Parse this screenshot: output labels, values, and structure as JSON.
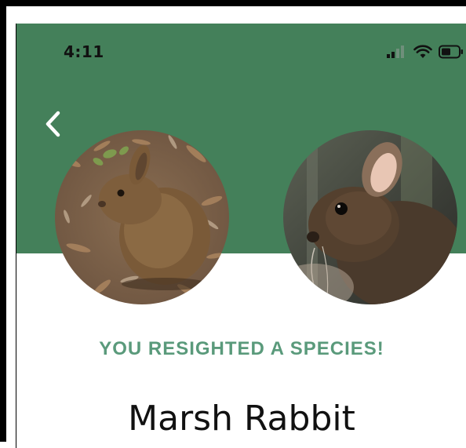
{
  "status_bar": {
    "time": "4:11",
    "signal_icon": "cellular-signal-icon",
    "wifi_icon": "wifi-icon",
    "battery_icon": "battery-icon"
  },
  "nav": {
    "back_icon": "chevron-left-icon"
  },
  "photos": [
    {
      "name": "rabbit-photo-left"
    },
    {
      "name": "rabbit-photo-right"
    }
  ],
  "main": {
    "banner": "YOU RESIGHTED A SPECIES!",
    "species_name": "Marsh Rabbit"
  },
  "colors": {
    "header_green": "#44805a",
    "banner_green": "#5a9a7b",
    "text_dark": "#111111"
  }
}
